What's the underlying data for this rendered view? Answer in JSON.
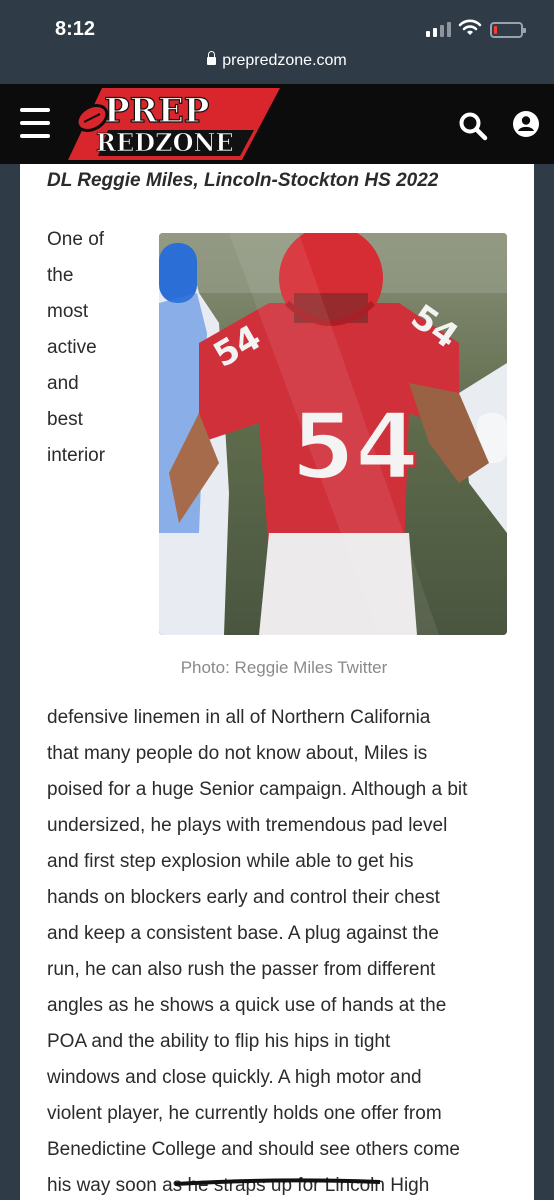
{
  "status_bar": {
    "time": "8:12",
    "icons": [
      "signal-icon",
      "wifi-icon",
      "battery-icon"
    ]
  },
  "browser": {
    "url": "prepredzone.com"
  },
  "site_header": {
    "logo_line1": "PREP",
    "logo_line2": "REDZONE",
    "icons": [
      "menu-icon",
      "search-icon",
      "user-icon"
    ],
    "colors": {
      "brand_red": "#d8262c",
      "header_bg": "#0c0c0c"
    }
  },
  "article": {
    "headline": "DL Reggie Miles, Lincoln-Stockton HS 2022",
    "wrap_words": [
      "One of",
      "the",
      "most",
      "active",
      "and",
      "best",
      "interior"
    ],
    "photo_caption": "Photo: Reggie Miles Twitter",
    "jersey_number": "54",
    "body_lines": [
      "defensive linemen in all of Northern California",
      "that many people do not know about, Miles is",
      "poised for a huge Senior campaign. Although a bit",
      "undersized, he plays with tremendous pad level",
      "and first step explosion while able to get his",
      "hands on blockers early and control their chest",
      "and keep a consistent base. A plug against the",
      "run, he can also rush the passer from different",
      "angles as he shows a quick use of hands at the",
      "POA and the ability to flip his hips in tight",
      "windows and close quickly. A high motor and",
      "violent player, he currently holds one offer from",
      "Benedictine College and should see others come",
      "his way soon as he straps up for Lincoln High"
    ]
  }
}
